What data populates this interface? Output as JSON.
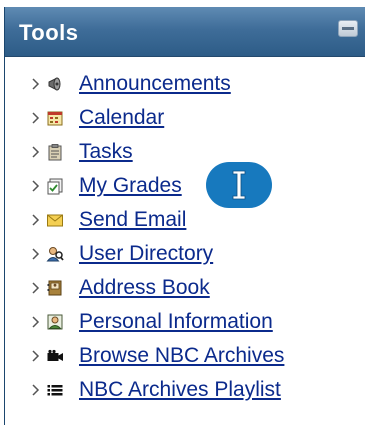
{
  "panel": {
    "title": "Tools",
    "collapse_button": "collapse-icon"
  },
  "tools": [
    {
      "label": "Announcements",
      "icon": "megaphone-icon"
    },
    {
      "label": "Calendar",
      "icon": "calendar-icon"
    },
    {
      "label": "Tasks",
      "icon": "clipboard-icon"
    },
    {
      "label": "My Grades",
      "icon": "grades-icon"
    },
    {
      "label": "Send Email",
      "icon": "envelope-icon"
    },
    {
      "label": "User Directory",
      "icon": "user-search-icon"
    },
    {
      "label": "Address Book",
      "icon": "address-book-icon"
    },
    {
      "label": "Personal Information",
      "icon": "personal-info-icon"
    },
    {
      "label": "Browse NBC Archives",
      "icon": "video-camera-icon"
    },
    {
      "label": "NBC Archives Playlist",
      "icon": "playlist-icon"
    }
  ],
  "colors": {
    "header": "#3f6d99",
    "link": "#0b2a8c",
    "cursor_badge": "#1779be"
  }
}
